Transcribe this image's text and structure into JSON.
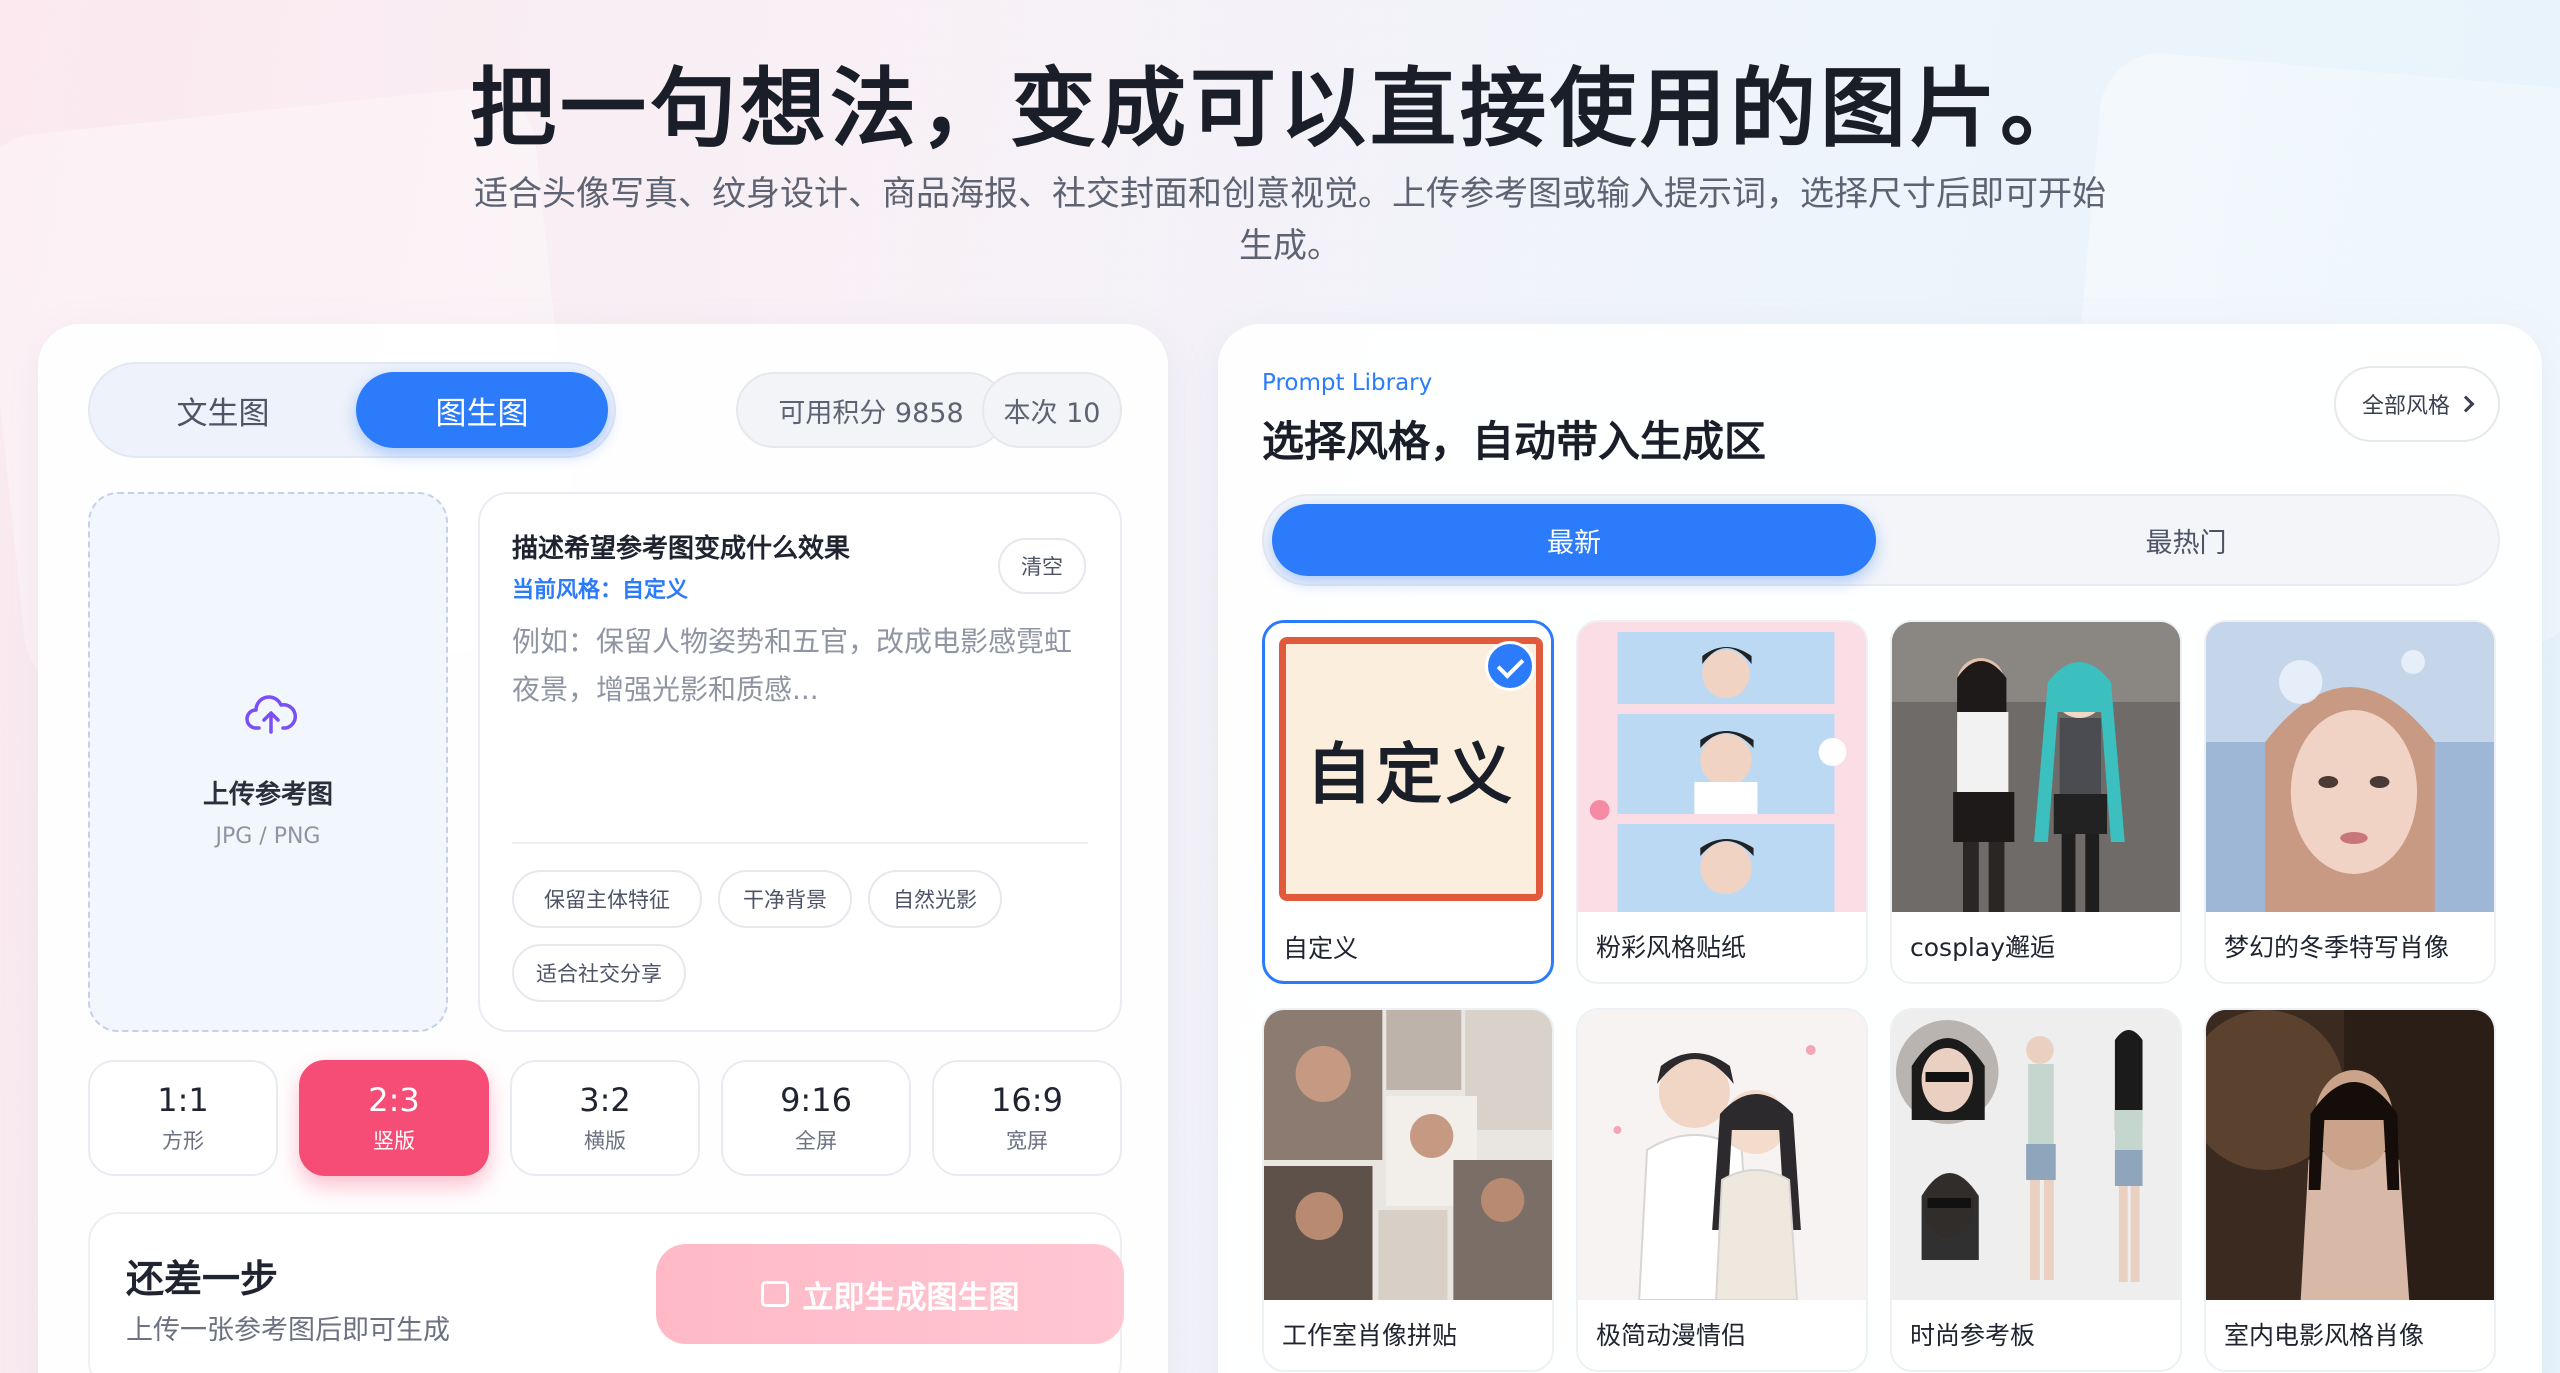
{
  "hero": {
    "title": "把一句想法，变成可以直接使用的图片。",
    "subtitle": "适合头像写真、纹身设计、商品海报、社交封面和创意视觉。上传参考图或输入提示词，选择尺寸后即可开始生成。"
  },
  "mode_tabs": [
    {
      "label": "文生图",
      "active": false
    },
    {
      "label": "图生图",
      "active": true
    }
  ],
  "credits": "可用积分 9858",
  "cost": "本次 10",
  "upload": {
    "title": "上传参考图",
    "formats": "JPG / PNG",
    "icon": "cloud-upload-icon"
  },
  "prompt": {
    "title": "描述希望参考图变成什么效果",
    "current_style": "当前风格：自定义",
    "clear_label": "清空",
    "placeholder": "例如：保留人物姿势和五官，改成电影感霓虹夜景，增强光影和质感..."
  },
  "chips": [
    "保留主体特征",
    "干净背景",
    "自然光影",
    "适合社交分享"
  ],
  "ratios": [
    {
      "value": "1:1",
      "label": "方形",
      "active": false
    },
    {
      "value": "2:3",
      "label": "竖版",
      "active": true
    },
    {
      "value": "3:2",
      "label": "横版",
      "active": false
    },
    {
      "value": "9:16",
      "label": "全屏",
      "active": false
    },
    {
      "value": "16:9",
      "label": "宽屏",
      "active": false
    }
  ],
  "action": {
    "title": "还差一步",
    "subtitle": "上传一张参考图后即可生成",
    "button_label": "立即生成图生图",
    "button_icon": "upload-box-icon"
  },
  "library": {
    "kicker": "Prompt Library",
    "title": "选择风格，自动带入生成区",
    "all_styles": "全部风格",
    "tabs": [
      {
        "label": "最新",
        "active": true
      },
      {
        "label": "最热门",
        "active": false
      }
    ],
    "custom_art_text": "自定义",
    "styles": [
      {
        "label": "自定义",
        "selected": true
      },
      {
        "label": "粉彩风格贴纸",
        "selected": false
      },
      {
        "label": "cosplay邂逅",
        "selected": false
      },
      {
        "label": "梦幻的冬季特写肖像",
        "selected": false
      },
      {
        "label": "工作室肖像拼贴",
        "selected": false
      },
      {
        "label": "极简动漫情侣",
        "selected": false
      },
      {
        "label": "时尚参考板",
        "selected": false
      },
      {
        "label": "室内电影风格肖像",
        "selected": false
      }
    ]
  },
  "colors": {
    "accent_blue": "#2b7bfa",
    "accent_pink": "#f54d75",
    "button_disabled_pink": "#ffbfcc"
  }
}
